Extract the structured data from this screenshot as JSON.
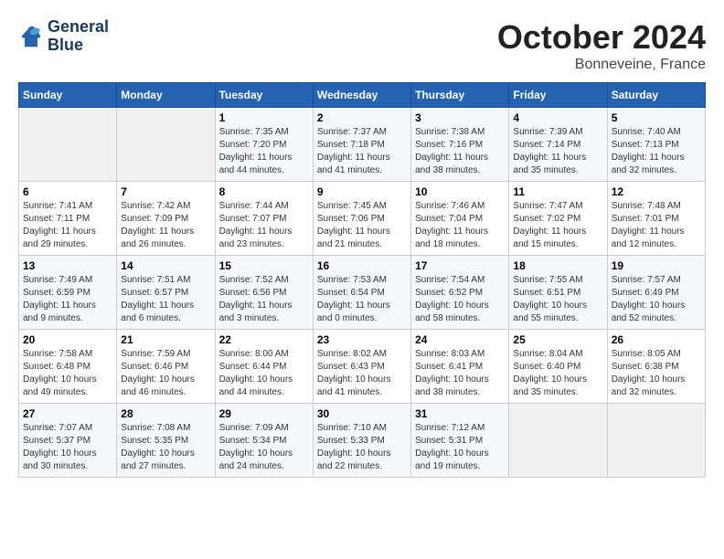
{
  "header": {
    "logo_line1": "General",
    "logo_line2": "Blue",
    "month": "October 2024",
    "location": "Bonneveine, France"
  },
  "columns": [
    "Sunday",
    "Monday",
    "Tuesday",
    "Wednesday",
    "Thursday",
    "Friday",
    "Saturday"
  ],
  "weeks": [
    [
      {
        "num": "",
        "sunrise": "",
        "sunset": "",
        "daylight": "",
        "empty": true
      },
      {
        "num": "",
        "sunrise": "",
        "sunset": "",
        "daylight": "",
        "empty": true
      },
      {
        "num": "1",
        "sunrise": "Sunrise: 7:35 AM",
        "sunset": "Sunset: 7:20 PM",
        "daylight": "Daylight: 11 hours and 44 minutes."
      },
      {
        "num": "2",
        "sunrise": "Sunrise: 7:37 AM",
        "sunset": "Sunset: 7:18 PM",
        "daylight": "Daylight: 11 hours and 41 minutes."
      },
      {
        "num": "3",
        "sunrise": "Sunrise: 7:38 AM",
        "sunset": "Sunset: 7:16 PM",
        "daylight": "Daylight: 11 hours and 38 minutes."
      },
      {
        "num": "4",
        "sunrise": "Sunrise: 7:39 AM",
        "sunset": "Sunset: 7:14 PM",
        "daylight": "Daylight: 11 hours and 35 minutes."
      },
      {
        "num": "5",
        "sunrise": "Sunrise: 7:40 AM",
        "sunset": "Sunset: 7:13 PM",
        "daylight": "Daylight: 11 hours and 32 minutes."
      }
    ],
    [
      {
        "num": "6",
        "sunrise": "Sunrise: 7:41 AM",
        "sunset": "Sunset: 7:11 PM",
        "daylight": "Daylight: 11 hours and 29 minutes."
      },
      {
        "num": "7",
        "sunrise": "Sunrise: 7:42 AM",
        "sunset": "Sunset: 7:09 PM",
        "daylight": "Daylight: 11 hours and 26 minutes."
      },
      {
        "num": "8",
        "sunrise": "Sunrise: 7:44 AM",
        "sunset": "Sunset: 7:07 PM",
        "daylight": "Daylight: 11 hours and 23 minutes."
      },
      {
        "num": "9",
        "sunrise": "Sunrise: 7:45 AM",
        "sunset": "Sunset: 7:06 PM",
        "daylight": "Daylight: 11 hours and 21 minutes."
      },
      {
        "num": "10",
        "sunrise": "Sunrise: 7:46 AM",
        "sunset": "Sunset: 7:04 PM",
        "daylight": "Daylight: 11 hours and 18 minutes."
      },
      {
        "num": "11",
        "sunrise": "Sunrise: 7:47 AM",
        "sunset": "Sunset: 7:02 PM",
        "daylight": "Daylight: 11 hours and 15 minutes."
      },
      {
        "num": "12",
        "sunrise": "Sunrise: 7:48 AM",
        "sunset": "Sunset: 7:01 PM",
        "daylight": "Daylight: 11 hours and 12 minutes."
      }
    ],
    [
      {
        "num": "13",
        "sunrise": "Sunrise: 7:49 AM",
        "sunset": "Sunset: 6:59 PM",
        "daylight": "Daylight: 11 hours and 9 minutes."
      },
      {
        "num": "14",
        "sunrise": "Sunrise: 7:51 AM",
        "sunset": "Sunset: 6:57 PM",
        "daylight": "Daylight: 11 hours and 6 minutes."
      },
      {
        "num": "15",
        "sunrise": "Sunrise: 7:52 AM",
        "sunset": "Sunset: 6:56 PM",
        "daylight": "Daylight: 11 hours and 3 minutes."
      },
      {
        "num": "16",
        "sunrise": "Sunrise: 7:53 AM",
        "sunset": "Sunset: 6:54 PM",
        "daylight": "Daylight: 11 hours and 0 minutes."
      },
      {
        "num": "17",
        "sunrise": "Sunrise: 7:54 AM",
        "sunset": "Sunset: 6:52 PM",
        "daylight": "Daylight: 10 hours and 58 minutes."
      },
      {
        "num": "18",
        "sunrise": "Sunrise: 7:55 AM",
        "sunset": "Sunset: 6:51 PM",
        "daylight": "Daylight: 10 hours and 55 minutes."
      },
      {
        "num": "19",
        "sunrise": "Sunrise: 7:57 AM",
        "sunset": "Sunset: 6:49 PM",
        "daylight": "Daylight: 10 hours and 52 minutes."
      }
    ],
    [
      {
        "num": "20",
        "sunrise": "Sunrise: 7:58 AM",
        "sunset": "Sunset: 6:48 PM",
        "daylight": "Daylight: 10 hours and 49 minutes."
      },
      {
        "num": "21",
        "sunrise": "Sunrise: 7:59 AM",
        "sunset": "Sunset: 6:46 PM",
        "daylight": "Daylight: 10 hours and 46 minutes."
      },
      {
        "num": "22",
        "sunrise": "Sunrise: 8:00 AM",
        "sunset": "Sunset: 6:44 PM",
        "daylight": "Daylight: 10 hours and 44 minutes."
      },
      {
        "num": "23",
        "sunrise": "Sunrise: 8:02 AM",
        "sunset": "Sunset: 6:43 PM",
        "daylight": "Daylight: 10 hours and 41 minutes."
      },
      {
        "num": "24",
        "sunrise": "Sunrise: 8:03 AM",
        "sunset": "Sunset: 6:41 PM",
        "daylight": "Daylight: 10 hours and 38 minutes."
      },
      {
        "num": "25",
        "sunrise": "Sunrise: 8:04 AM",
        "sunset": "Sunset: 6:40 PM",
        "daylight": "Daylight: 10 hours and 35 minutes."
      },
      {
        "num": "26",
        "sunrise": "Sunrise: 8:05 AM",
        "sunset": "Sunset: 6:38 PM",
        "daylight": "Daylight: 10 hours and 32 minutes."
      }
    ],
    [
      {
        "num": "27",
        "sunrise": "Sunrise: 7:07 AM",
        "sunset": "Sunset: 5:37 PM",
        "daylight": "Daylight: 10 hours and 30 minutes."
      },
      {
        "num": "28",
        "sunrise": "Sunrise: 7:08 AM",
        "sunset": "Sunset: 5:35 PM",
        "daylight": "Daylight: 10 hours and 27 minutes."
      },
      {
        "num": "29",
        "sunrise": "Sunrise: 7:09 AM",
        "sunset": "Sunset: 5:34 PM",
        "daylight": "Daylight: 10 hours and 24 minutes."
      },
      {
        "num": "30",
        "sunrise": "Sunrise: 7:10 AM",
        "sunset": "Sunset: 5:33 PM",
        "daylight": "Daylight: 10 hours and 22 minutes."
      },
      {
        "num": "31",
        "sunrise": "Sunrise: 7:12 AM",
        "sunset": "Sunset: 5:31 PM",
        "daylight": "Daylight: 10 hours and 19 minutes."
      },
      {
        "num": "",
        "sunrise": "",
        "sunset": "",
        "daylight": "",
        "empty": true
      },
      {
        "num": "",
        "sunrise": "",
        "sunset": "",
        "daylight": "",
        "empty": true
      }
    ]
  ]
}
